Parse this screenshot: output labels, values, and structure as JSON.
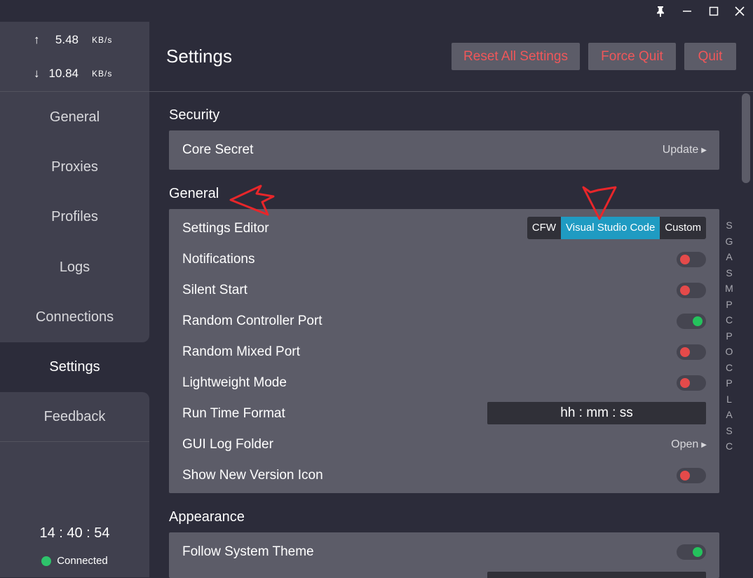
{
  "window_controls": {
    "pin": "🖈",
    "minimize": "—",
    "maximize": "☐",
    "close": "✕"
  },
  "traffic": {
    "upload": {
      "arrow": "↑",
      "value": "5.48",
      "unit": "KB/s"
    },
    "download": {
      "arrow": "↓",
      "value": "10.84",
      "unit": "KB/s"
    }
  },
  "nav": [
    {
      "label": "General"
    },
    {
      "label": "Proxies"
    },
    {
      "label": "Profiles"
    },
    {
      "label": "Logs"
    },
    {
      "label": "Connections"
    },
    {
      "label": "Settings",
      "active": true
    },
    {
      "label": "Feedback"
    }
  ],
  "clock": "14 : 40 : 54",
  "status": {
    "text": "Connected",
    "color": "#2ec36b"
  },
  "header": {
    "title": "Settings",
    "buttons": {
      "reset": "Reset All Settings",
      "force_quit": "Force Quit",
      "quit": "Quit"
    }
  },
  "sections": {
    "security": {
      "title": "Security",
      "core_secret": {
        "label": "Core Secret",
        "action": "Update"
      }
    },
    "general": {
      "title": "General",
      "settings_editor": {
        "label": "Settings Editor",
        "options": [
          "CFW",
          "Visual Studio Code",
          "Custom"
        ],
        "selected": "Visual Studio Code"
      },
      "notifications": {
        "label": "Notifications",
        "on": false
      },
      "silent_start": {
        "label": "Silent Start",
        "on": false
      },
      "random_controller_port": {
        "label": "Random Controller Port",
        "on": true
      },
      "random_mixed_port": {
        "label": "Random Mixed Port",
        "on": false
      },
      "lightweight_mode": {
        "label": "Lightweight Mode",
        "on": false
      },
      "run_time_format": {
        "label": "Run Time Format",
        "value": "hh : mm : ss"
      },
      "gui_log_folder": {
        "label": "GUI Log Folder",
        "action": "Open"
      },
      "show_new_version_icon": {
        "label": "Show New Version Icon",
        "on": false
      }
    },
    "appearance": {
      "title": "Appearance",
      "follow_system_theme": {
        "label": "Follow System Theme",
        "on": true
      }
    }
  },
  "index_letters": [
    "S",
    "G",
    "A",
    "S",
    "M",
    "P",
    "C",
    "P",
    "O",
    "C",
    "P",
    "L",
    "A",
    "S",
    "C"
  ],
  "colors": {
    "accent": "#1f9bc2",
    "danger_text": "#f0575a",
    "toggle_on": "#24c25c",
    "toggle_off": "#e44a4a",
    "annotation": "#e8262a"
  }
}
